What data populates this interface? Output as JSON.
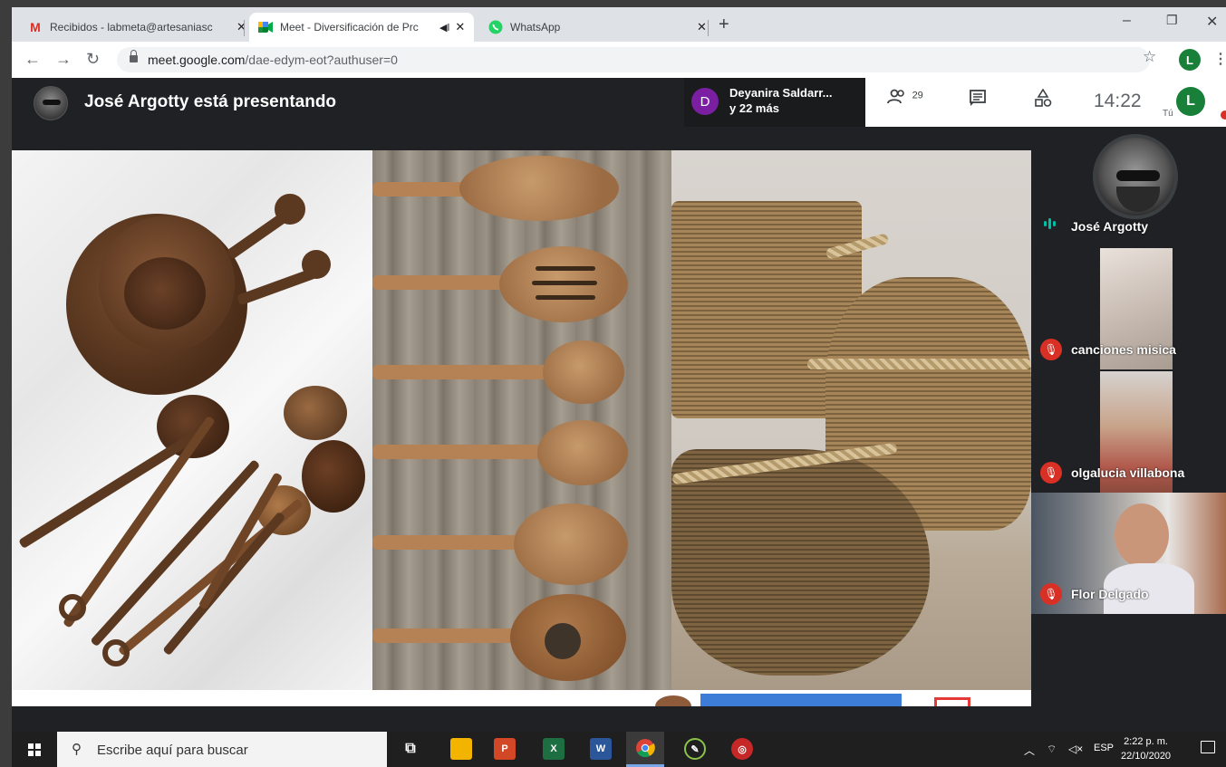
{
  "browser": {
    "tabs": [
      {
        "title": "Recibidos - labmeta@artesaniasc",
        "icon": "gmail-icon"
      },
      {
        "title": "Meet - Diversificación de Prc",
        "icon": "meet-icon",
        "audio": "speaker-icon"
      },
      {
        "title": "WhatsApp",
        "icon": "whatsapp-icon"
      }
    ],
    "url_domain": "meet.google.com",
    "url_path": "/dae-edym-eot?authuser=0",
    "profile_initial": "L"
  },
  "meet": {
    "presenting_text": "José Argotty está presentando",
    "joined": {
      "initial": "D",
      "line1": "Deyanira Saldarr...",
      "line2": "y 22 más"
    },
    "people_count": "29",
    "time": "14:22",
    "self_label": "Tú",
    "self_initial": "L",
    "participants": [
      {
        "name": "José Argotty",
        "state": "speaking"
      },
      {
        "name": "canciones misica",
        "state": "muted"
      },
      {
        "name": "olgalucia villabona",
        "state": "muted"
      },
      {
        "name": "Flor Delgado",
        "state": "muted"
      }
    ]
  },
  "taskbar": {
    "search_placeholder": "Escribe aquí para buscar",
    "lang": "ESP",
    "clock_time": "2:22 p. m.",
    "clock_date": "22/10/2020"
  },
  "colors": {
    "meet_bg": "#202124",
    "muted_red": "#d93025",
    "speaking_teal": "#00bfa5",
    "profile_green": "#188038",
    "joiner_purple": "#7b1fa2"
  }
}
